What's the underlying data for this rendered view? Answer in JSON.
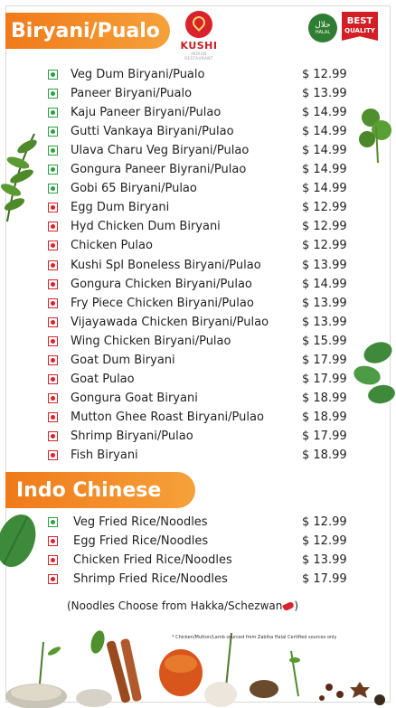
{
  "header": {
    "title": "Biryani/Pualo",
    "logo_name": "KUSHI",
    "logo_tagline": "INDIAN RESTAURANT",
    "halal_badge": "حلال",
    "halal_badge_sub": "HALAL",
    "best_badge_line1": "BEST",
    "best_badge_line2": "QUALITY"
  },
  "colors": {
    "banner": "#f07a1a",
    "veg": "#2ea043",
    "nonveg": "#d8232a"
  },
  "biryani": [
    {
      "name": "Veg Dum Biryani/Pualo",
      "price": "$ 12.99",
      "type": "veg"
    },
    {
      "name": "Paneer Biryani/Pualo",
      "price": "$ 13.99",
      "type": "veg"
    },
    {
      "name": "Kaju Paneer Biryani/Pulao",
      "price": "$ 14.99",
      "type": "veg"
    },
    {
      "name": "Gutti Vankaya Biryani/Pulao",
      "price": "$ 14.99",
      "type": "veg"
    },
    {
      "name": "Ulava Charu Veg Biryani/Pulao",
      "price": "$ 14.99",
      "type": "veg"
    },
    {
      "name": "Gongura Paneer Biyrani/Pulao",
      "price": "$ 14.99",
      "type": "veg"
    },
    {
      "name": "Gobi 65 Biryani/Pulao",
      "price": "$ 14.99",
      "type": "veg"
    },
    {
      "name": "Egg Dum Biryani",
      "price": "$ 12.99",
      "type": "nonveg"
    },
    {
      "name": "Hyd Chicken Dum Biryani",
      "price": "$ 12.99",
      "type": "nonveg"
    },
    {
      "name": "Chicken Pulao",
      "price": "$ 12.99",
      "type": "nonveg"
    },
    {
      "name": "Kushi Spl Boneless Biryani/Pulao",
      "price": "$ 13.99",
      "type": "nonveg"
    },
    {
      "name": "Gongura Chicken Biryani/Pulao",
      "price": "$ 14.99",
      "type": "nonveg"
    },
    {
      "name": "Fry Piece Chicken Biryani/Pulao",
      "price": "$ 13.99",
      "type": "nonveg"
    },
    {
      "name": "Vijayawada Chicken Biryani/Pulao",
      "price": "$ 13.99",
      "type": "nonveg"
    },
    {
      "name": "Wing Chicken Biryani/Pulao",
      "price": "$ 15.99",
      "type": "nonveg"
    },
    {
      "name": "Goat Dum Biryani",
      "price": "$ 17.99",
      "type": "nonveg"
    },
    {
      "name": "Goat Pulao",
      "price": "$ 17.99",
      "type": "nonveg"
    },
    {
      "name": "Gongura Goat Biryani",
      "price": "$ 18.99",
      "type": "nonveg"
    },
    {
      "name": "Mutton Ghee Roast Biryani/Pulao",
      "price": "$ 18.99",
      "type": "nonveg"
    },
    {
      "name": "Shrimp Biryani/Pulao",
      "price": "$ 17.99",
      "type": "nonveg"
    },
    {
      "name": "Fish Biryani",
      "price": "$ 18.99",
      "type": "nonveg"
    }
  ],
  "indo_chinese": {
    "title": "Indo Chinese",
    "items": [
      {
        "name": "Veg Fried Rice/Noodles",
        "price": "$ 12.99",
        "type": "veg"
      },
      {
        "name": "Egg Fried Rice/Noodles",
        "price": "$ 12.99",
        "type": "nonveg"
      },
      {
        "name": "Chicken Fried Rice/Noodles",
        "price": "$ 13.99",
        "type": "nonveg"
      },
      {
        "name": "Shrimp Fried Rice/Noodles",
        "price": "$ 17.99",
        "type": "nonveg"
      }
    ],
    "note": "(Noodles Choose from Hakka/Schezwan",
    "note_end": ")"
  },
  "footnote": "* Chicken/Mutton/Lamb sourced from Zabiha Halal Certified sources only"
}
